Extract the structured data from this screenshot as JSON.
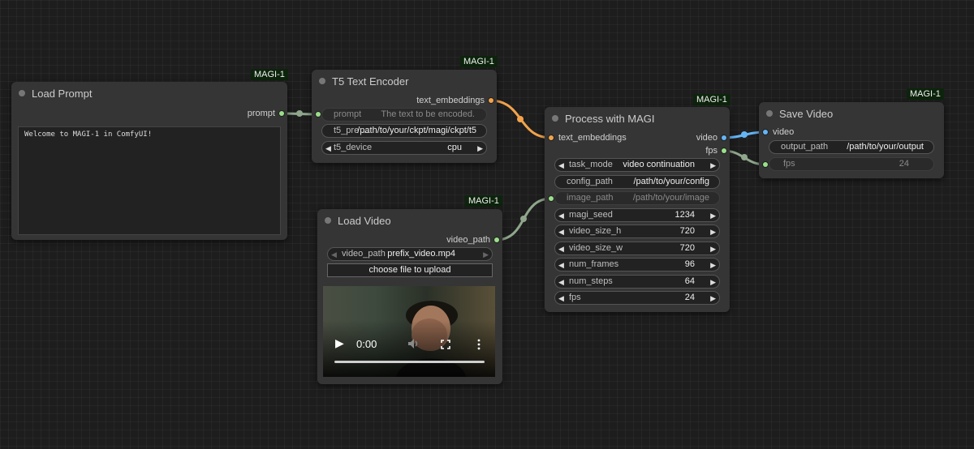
{
  "badge": "MAGI-1",
  "colors": {
    "canvas": "#1d1d1d",
    "node_bg": "#353535",
    "badge_bg": "#0c240c",
    "port_string": "#9adf8a",
    "port_embeddings": "#f2a34c",
    "port_video": "#64b5f6"
  },
  "load_prompt": {
    "title": "Load Prompt",
    "output": "prompt",
    "text": "Welcome to MAGI-1 in ComfyUI!"
  },
  "t5": {
    "title": "T5 Text Encoder",
    "output": "text_embeddings",
    "input_name": "prompt",
    "input_placeholder": "The text to be encoded.",
    "widgets": [
      {
        "name": "t5_pre ...",
        "value": "/path/to/your/ckpt/magi/ckpt/t5"
      },
      {
        "name": "t5_device",
        "value": "cpu"
      }
    ]
  },
  "load_video": {
    "title": "Load Video",
    "output": "video_path",
    "widget": {
      "name": "video_path",
      "value": "prefix_video.mp4"
    },
    "upload_label": "choose file to upload",
    "video_time": "0:00"
  },
  "process": {
    "title": "Process with MAGI",
    "input": "text_embeddings",
    "outputs": [
      "video",
      "fps"
    ],
    "widgets": [
      {
        "name": "task_mode",
        "value": "video continuation"
      },
      {
        "name": "config_path",
        "value": "/path/to/your/config"
      },
      {
        "name": "image_path",
        "value": "/path/to/your/image"
      },
      {
        "name": "magi_seed",
        "value": "1234"
      },
      {
        "name": "video_size_h",
        "value": "720"
      },
      {
        "name": "video_size_w",
        "value": "720"
      },
      {
        "name": "num_frames",
        "value": "96"
      },
      {
        "name": "num_steps",
        "value": "64"
      },
      {
        "name": "fps",
        "value": "24"
      }
    ]
  },
  "save": {
    "title": "Save Video",
    "input": "video",
    "widgets": [
      {
        "name": "output_path",
        "value": "/path/to/your/output"
      },
      {
        "name": "fps",
        "value": "24"
      }
    ]
  }
}
